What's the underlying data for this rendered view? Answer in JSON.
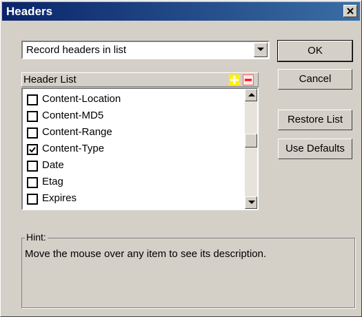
{
  "dialog": {
    "title": "Headers"
  },
  "mode_select": {
    "value": "Record headers in list"
  },
  "header_list": {
    "label": "Header List",
    "items": [
      {
        "label": "Content-Location",
        "checked": false
      },
      {
        "label": "Content-MD5",
        "checked": false
      },
      {
        "label": "Content-Range",
        "checked": false
      },
      {
        "label": "Content-Type",
        "checked": true
      },
      {
        "label": "Date",
        "checked": false
      },
      {
        "label": "Etag",
        "checked": false
      },
      {
        "label": "Expires",
        "checked": false
      }
    ]
  },
  "buttons": {
    "ok": "OK",
    "cancel": "Cancel",
    "restore": "Restore List",
    "defaults": "Use Defaults"
  },
  "hint": {
    "label": "Hint:",
    "text": "Move the mouse over any item to see its description."
  },
  "colors": {
    "titlebar": "#0a246a",
    "add": "#ffef00",
    "remove": "#ff0000"
  },
  "icons": {
    "close": "close-icon",
    "add": "plus-icon",
    "remove": "minus-icon",
    "dropdown": "chevron-down-icon"
  }
}
